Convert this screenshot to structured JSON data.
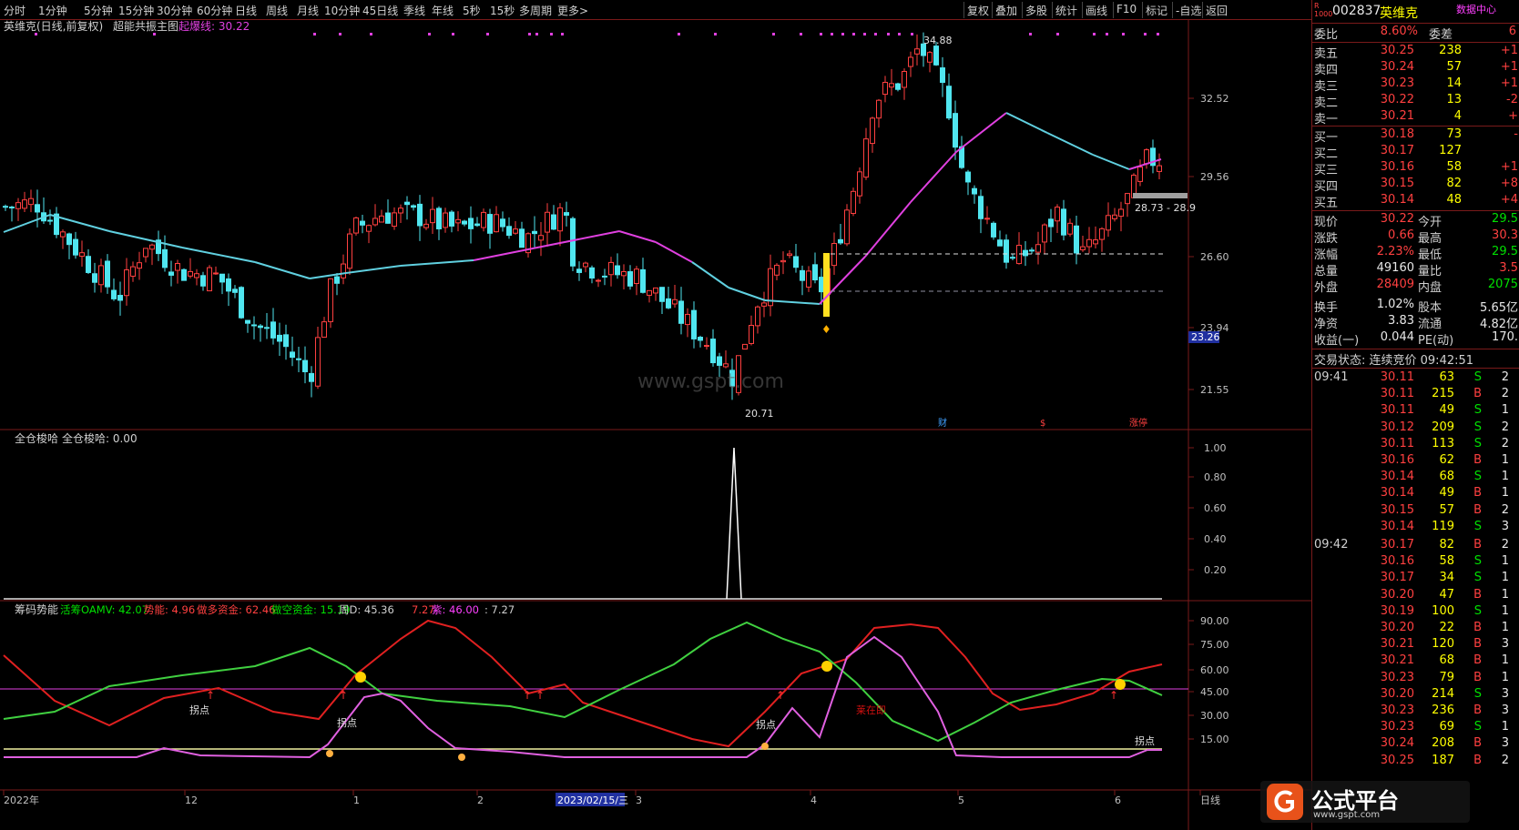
{
  "toolbar": {
    "left": [
      "分时",
      "1分钟",
      "5分钟",
      "15分钟",
      "30分钟",
      "60分钟",
      "日线",
      "周线",
      "月线",
      "10分钟",
      "45日线",
      "季线",
      "年线",
      "5秒",
      "15秒",
      "多周期",
      "更多>"
    ],
    "right": [
      "复权",
      "叠加",
      "多股",
      "统计",
      "画线",
      "F10",
      "标记",
      "-自选",
      "返回"
    ]
  },
  "main_pane": {
    "title": "英维克(日线,前复权)",
    "indicator_name": "超能共振主图",
    "indicator_label": "起爆线: 30.22",
    "y_labels": [
      "32.52",
      "29.56",
      "26.60",
      "23.94",
      "21.55"
    ],
    "current_price_tag": "23.26",
    "high_label": "34.88",
    "low_label": "20.71",
    "range_label": "28.73 - 28.9",
    "event_marks": [
      "财",
      "$",
      "涨停"
    ],
    "watermark": "www.gspt.com"
  },
  "pane2": {
    "title": "全仓梭哈",
    "value_label": "全仓梭哈: 0.00",
    "y_labels": [
      "1.00",
      "0.80",
      "0.60",
      "0.40",
      "0.20"
    ]
  },
  "pane3": {
    "title": "筹码势能",
    "legend": [
      {
        "text": "活筹OAMV: 42.07",
        "color": "#00e000"
      },
      {
        "text": "势能: 4.96",
        "color": "#ff4040"
      },
      {
        "text": "做多资金: 62.46",
        "color": "#ff4040"
      },
      {
        "text": "做空资金: 15.19",
        "color": "#00e000"
      },
      {
        "text": "周D: 45.36",
        "color": "#d0d0d0"
      },
      {
        "text": "7.27",
        "color": "#ff4040"
      },
      {
        "text": "紫: 46.00",
        "color": "#ff40ff"
      },
      {
        "text": ": 7.27",
        "color": "#d0d0d0"
      }
    ],
    "y_labels": [
      "90.00",
      "75.00",
      "60.00",
      "45.00",
      "30.00",
      "15.00"
    ],
    "annotations": [
      "拐点",
      "拐点",
      "拐点",
      "拐点",
      "莱在即"
    ]
  },
  "x_axis": {
    "labels": [
      "2022年",
      "12",
      "1",
      "2",
      "3",
      "4",
      "5",
      "6",
      "日线"
    ],
    "cursor_date": "2023/02/15/三"
  },
  "quote": {
    "code": "002837",
    "name": "英维克",
    "data_center": "数据中心",
    "wei_bi": {
      "label": "委比",
      "value": "8.60%",
      "label2": "委差",
      "value2": "6"
    },
    "asks": [
      {
        "label": "卖五",
        "price": "30.25",
        "vol": "238",
        "chg": "+1"
      },
      {
        "label": "卖四",
        "price": "30.24",
        "vol": "57",
        "chg": "+1"
      },
      {
        "label": "卖三",
        "price": "30.23",
        "vol": "14",
        "chg": "+1"
      },
      {
        "label": "卖二",
        "price": "30.22",
        "vol": "13",
        "chg": "-2"
      },
      {
        "label": "卖一",
        "price": "30.21",
        "vol": "4",
        "chg": "+"
      }
    ],
    "bids": [
      {
        "label": "买一",
        "price": "30.18",
        "vol": "73",
        "chg": "-"
      },
      {
        "label": "买二",
        "price": "30.17",
        "vol": "127",
        "chg": ""
      },
      {
        "label": "买三",
        "price": "30.16",
        "vol": "58",
        "chg": "+1"
      },
      {
        "label": "买四",
        "price": "30.15",
        "vol": "82",
        "chg": "+8"
      },
      {
        "label": "买五",
        "price": "30.14",
        "vol": "48",
        "chg": "+4"
      }
    ],
    "stats": [
      {
        "l1": "现价",
        "v1": "30.22",
        "l2": "今开",
        "v2": "29.5",
        "c1": "red",
        "c2": "green"
      },
      {
        "l1": "涨跌",
        "v1": "0.66",
        "l2": "最高",
        "v2": "30.3",
        "c1": "red",
        "c2": "red"
      },
      {
        "l1": "涨幅",
        "v1": "2.23%",
        "l2": "最低",
        "v2": "29.5",
        "c1": "red",
        "c2": "green"
      },
      {
        "l1": "总量",
        "v1": "49160",
        "l2": "量比",
        "v2": "3.5",
        "c1": "white",
        "c2": "red"
      },
      {
        "l1": "外盘",
        "v1": "28409",
        "l2": "内盘",
        "v2": "2075",
        "c1": "red",
        "c2": "green"
      },
      {
        "l1": "换手",
        "v1": "1.02%",
        "l2": "股本",
        "v2": "5.65亿",
        "c1": "white",
        "c2": "white"
      },
      {
        "l1": "净资",
        "v1": "3.83",
        "l2": "流通",
        "v2": "4.82亿",
        "c1": "white",
        "c2": "white"
      },
      {
        "l1": "收益(一)",
        "v1": "0.044",
        "l2": "PE(动)",
        "v2": "170.",
        "c1": "white",
        "c2": "white"
      }
    ],
    "trade_status": "交易状态: 连续竞价 09:42:51",
    "ticks": [
      {
        "time": "09:41",
        "price": "30.11",
        "vol": "63",
        "side": "S",
        "n": "2"
      },
      {
        "time": "",
        "price": "30.11",
        "vol": "215",
        "side": "B",
        "n": "2"
      },
      {
        "time": "",
        "price": "30.11",
        "vol": "49",
        "side": "S",
        "n": "1"
      },
      {
        "time": "",
        "price": "30.12",
        "vol": "209",
        "side": "S",
        "n": "2"
      },
      {
        "time": "",
        "price": "30.11",
        "vol": "113",
        "side": "S",
        "n": "2"
      },
      {
        "time": "",
        "price": "30.16",
        "vol": "62",
        "side": "B",
        "n": "1"
      },
      {
        "time": "",
        "price": "30.14",
        "vol": "68",
        "side": "S",
        "n": "1"
      },
      {
        "time": "",
        "price": "30.14",
        "vol": "49",
        "side": "B",
        "n": "1"
      },
      {
        "time": "",
        "price": "30.15",
        "vol": "57",
        "side": "B",
        "n": "2"
      },
      {
        "time": "",
        "price": "30.14",
        "vol": "119",
        "side": "S",
        "n": "3"
      },
      {
        "time": "09:42",
        "price": "30.17",
        "vol": "82",
        "side": "B",
        "n": "2"
      },
      {
        "time": "",
        "price": "30.16",
        "vol": "58",
        "side": "S",
        "n": "1"
      },
      {
        "time": "",
        "price": "30.17",
        "vol": "34",
        "side": "S",
        "n": "1"
      },
      {
        "time": "",
        "price": "30.20",
        "vol": "47",
        "side": "B",
        "n": "1"
      },
      {
        "time": "",
        "price": "30.19",
        "vol": "100",
        "side": "S",
        "n": "1"
      },
      {
        "time": "",
        "price": "30.20",
        "vol": "22",
        "side": "B",
        "n": "1"
      },
      {
        "time": "",
        "price": "30.21",
        "vol": "120",
        "side": "B",
        "n": "3"
      },
      {
        "time": "",
        "price": "30.21",
        "vol": "68",
        "side": "B",
        "n": "1"
      },
      {
        "time": "",
        "price": "30.23",
        "vol": "79",
        "side": "B",
        "n": "1"
      },
      {
        "time": "",
        "price": "30.20",
        "vol": "214",
        "side": "S",
        "n": "3"
      },
      {
        "time": "",
        "price": "30.23",
        "vol": "236",
        "side": "B",
        "n": "3"
      },
      {
        "time": "",
        "price": "30.23",
        "vol": "69",
        "side": "S",
        "n": "1"
      },
      {
        "time": "",
        "price": "30.24",
        "vol": "208",
        "side": "B",
        "n": "3"
      },
      {
        "time": "",
        "price": "30.25",
        "vol": "187",
        "side": "B",
        "n": "2"
      }
    ]
  },
  "brand": {
    "name": "公式平台",
    "url": "www.gspt.com"
  },
  "colors": {
    "up": "#ff4040",
    "down": "#50e6f0",
    "ma_up": "#e040e0",
    "ma_down": "#60d0e0",
    "grid": "#7a1a1a"
  }
}
